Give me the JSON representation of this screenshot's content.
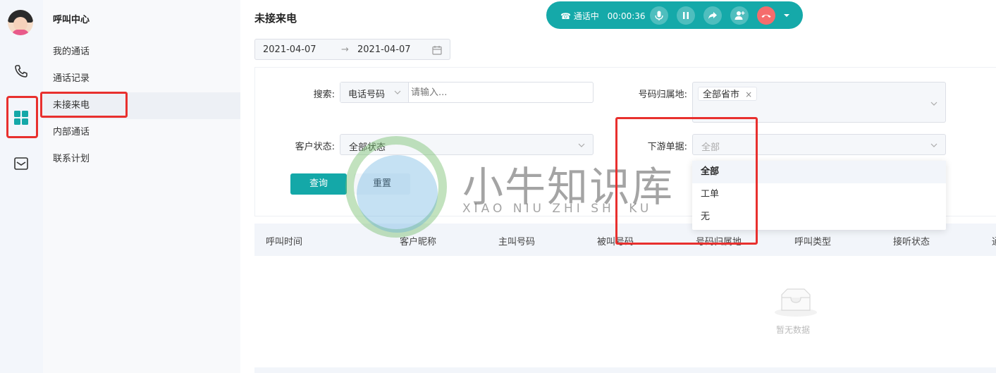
{
  "colors": {
    "accent": "#14a8a8",
    "highlight_box": "#e8302e",
    "hangup": "#f56c6c"
  },
  "sidebar": {
    "title": "呼叫中心",
    "items": [
      {
        "label": "我的通话"
      },
      {
        "label": "通话记录"
      },
      {
        "label": "未接来电"
      },
      {
        "label": "内部通话"
      },
      {
        "label": "联系计划"
      }
    ],
    "rail_icons": [
      "phone-icon",
      "grid-icon",
      "mail-icon"
    ]
  },
  "page": {
    "title": "未接来电"
  },
  "date_range": {
    "start": "2021-04-07",
    "separator": "→",
    "end": "2021-04-07"
  },
  "filters": {
    "search_label": "搜索:",
    "search_type": "电话号码",
    "search_placeholder": "请输入...",
    "region_label": "号码归属地:",
    "region_tag": "全部省市",
    "customer_status_label": "客户状态:",
    "customer_status_value": "全部状态",
    "downstream_label": "下游单据:",
    "downstream_placeholder": "全部",
    "downstream_options": [
      "全部",
      "工单",
      "无"
    ]
  },
  "buttons": {
    "query": "查询",
    "reset": "重置"
  },
  "table": {
    "columns": [
      "呼叫时间",
      "客户昵称",
      "主叫号码",
      "被叫号码",
      "号码归属地",
      "呼叫类型",
      "接听状态",
      "通"
    ],
    "empty_text": "暂无数据"
  },
  "call_bar": {
    "status": "通话中",
    "timer": "00:00:36"
  },
  "watermark": {
    "title": "小牛知识库",
    "subtitle": "XIAO NIU ZHI SHI KU"
  }
}
